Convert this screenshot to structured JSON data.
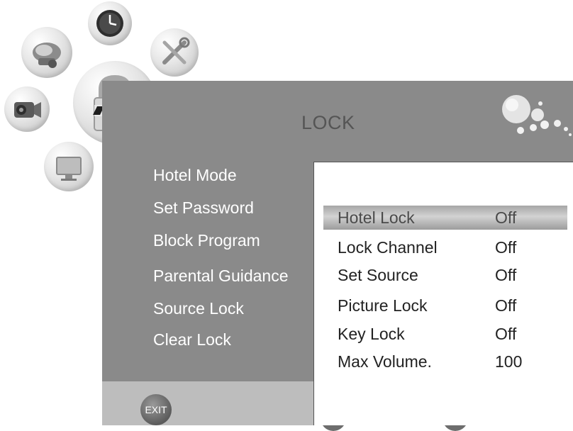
{
  "header": {
    "title": "LOCK"
  },
  "categories": [
    {
      "icon": "picture-icon"
    },
    {
      "icon": "clock-icon"
    },
    {
      "icon": "tools-icon"
    },
    {
      "icon": "camera-icon"
    },
    {
      "icon": "lock-icon"
    },
    {
      "icon": "monitor-icon"
    }
  ],
  "menu": {
    "items": [
      {
        "label": "Hotel  Mode"
      },
      {
        "label": "Set Password"
      },
      {
        "label": "Block Program"
      },
      {
        "label": "Parental Guidance"
      },
      {
        "label": "Source  Lock"
      },
      {
        "label": "Clear  Lock"
      }
    ]
  },
  "submenu": {
    "selected_index": 0,
    "rows": [
      {
        "label": "Hotel Lock",
        "value": "Off"
      },
      {
        "label": "Lock Channel",
        "value": "Off"
      },
      {
        "label": "Set Source",
        "value": "Off"
      },
      {
        "label": "Picture Lock",
        "value": "Off"
      },
      {
        "label": "Key Lock",
        "value": "Off"
      },
      {
        "label": "Max Volume.",
        "value": "100"
      }
    ]
  },
  "footer": {
    "exit_label": "EXIT"
  },
  "colors": {
    "panel": "#8a8a8a",
    "footer": "#bdbdbd",
    "highlight": "#b8b8b8"
  }
}
